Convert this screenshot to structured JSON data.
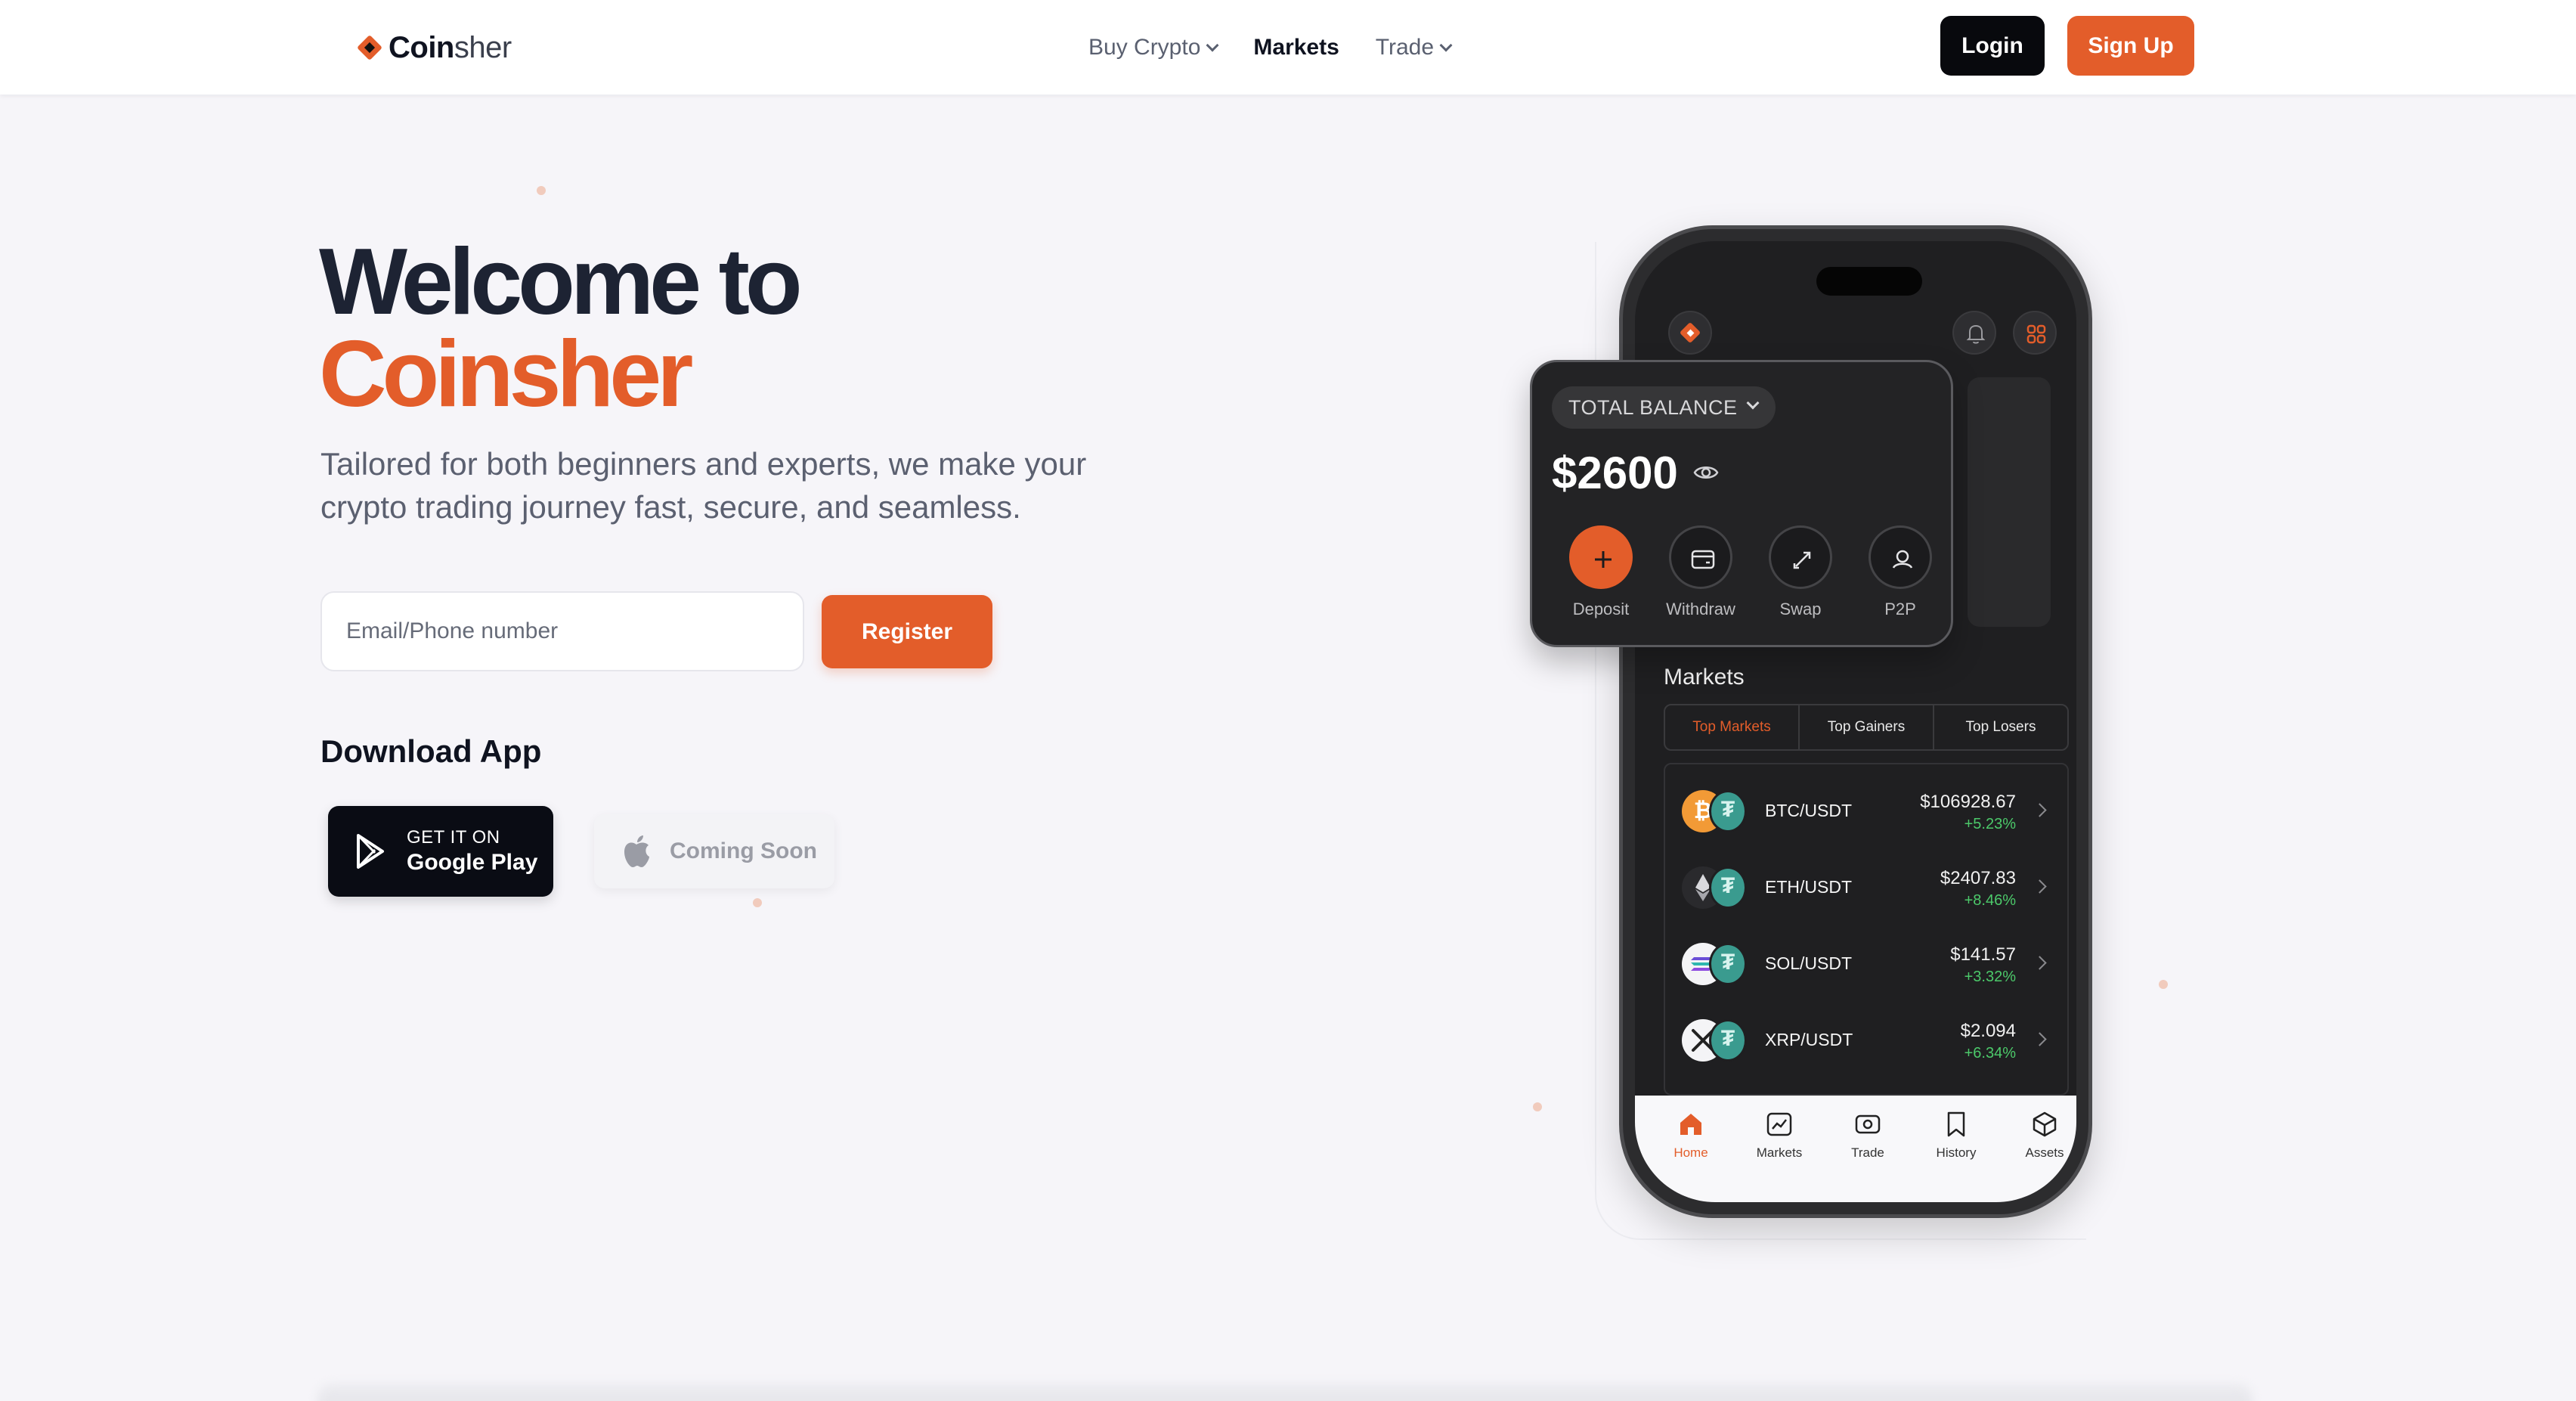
{
  "brand": {
    "name_bold": "Coin",
    "name_light": "sher"
  },
  "nav": {
    "links": [
      {
        "label": "Buy Crypto",
        "dropdown": true
      },
      {
        "label": "Markets",
        "dropdown": false
      },
      {
        "label": "Trade",
        "dropdown": true
      }
    ],
    "login_label": "Login",
    "signup_label": "Sign Up"
  },
  "hero": {
    "title_line1": "Welcome to",
    "title_line2": "Coinsher",
    "subtitle": "Tailored for both beginners and experts, we make your crypto trading journey fast, secure, and seamless.",
    "email_placeholder": "Email/Phone number",
    "register_label": "Register",
    "download_title": "Download App",
    "google_small": "GET IT ON",
    "google_big": "Google Play",
    "apple_label": "Coming Soon"
  },
  "phone": {
    "balance": {
      "label": "TOTAL BALANCE",
      "amount": "$2600",
      "actions": [
        {
          "label": "Deposit",
          "icon": "plus-icon"
        },
        {
          "label": "Withdraw",
          "icon": "wallet-icon"
        },
        {
          "label": "Swap",
          "icon": "swap-icon"
        },
        {
          "label": "P2P",
          "icon": "p2p-icon"
        }
      ]
    },
    "markets": {
      "title": "Markets",
      "tabs": [
        "Top Markets",
        "Top Gainers",
        "Top Losers"
      ],
      "active_tab": "Top Markets",
      "rows": [
        {
          "pair": "BTC/USDT",
          "price": "$106928.67",
          "change": "+5.23%",
          "coin": "bitcoin-icon"
        },
        {
          "pair": "ETH/USDT",
          "price": "$2407.83",
          "change": "+8.46%",
          "coin": "ethereum-icon"
        },
        {
          "pair": "SOL/USDT",
          "price": "$141.57",
          "change": "+3.32%",
          "coin": "solana-icon"
        },
        {
          "pair": "XRP/USDT",
          "price": "$2.094",
          "change": "+6.34%",
          "coin": "xrp-icon"
        }
      ]
    },
    "tabbar": [
      {
        "label": "Home",
        "icon": "home-icon"
      },
      {
        "label": "Markets",
        "icon": "chart-icon"
      },
      {
        "label": "Trade",
        "icon": "trade-icon"
      },
      {
        "label": "History",
        "icon": "bookmark-icon"
      },
      {
        "label": "Assets",
        "icon": "assets-icon"
      }
    ]
  },
  "colors": {
    "accent": "#e35d2a",
    "dark": "#08090d",
    "positive": "#4cc96a"
  }
}
